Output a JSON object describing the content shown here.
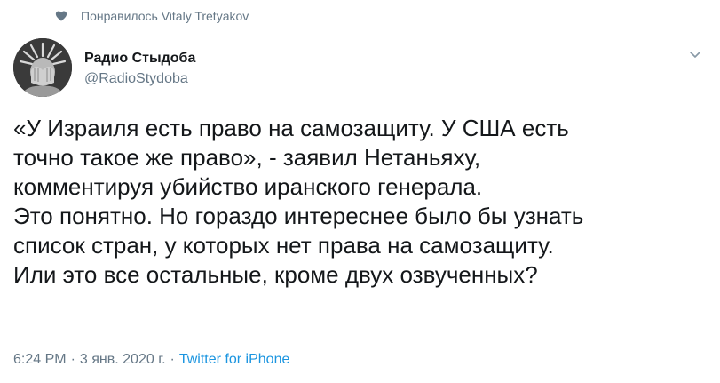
{
  "social_context": {
    "icon": "heart-icon",
    "text": "Понравилось Vitaly Tretyakov"
  },
  "author": {
    "display_name": "Радио Стыдоба",
    "handle": "@RadioStydoba",
    "avatar_icon": "avatar-image"
  },
  "tweet": {
    "text": "«У Израиля есть право на самозащиту. У США есть\nточно такое же право», - заявил Нетаньяху,\nкомментируя убийство иранского генерала.\nЭто понятно. Но гораздо интереснее было бы узнать\nсписок стран, у которых нет права на самозащиту.\nИли это все остальные, кроме двух озвученных?"
  },
  "meta": {
    "time": "6:24 PM",
    "date": "3 янв. 2020 г.",
    "separator": "·",
    "source": "Twitter for iPhone"
  },
  "colors": {
    "text_primary": "#14171a",
    "text_secondary": "#657786",
    "link": "#1b95e0"
  }
}
